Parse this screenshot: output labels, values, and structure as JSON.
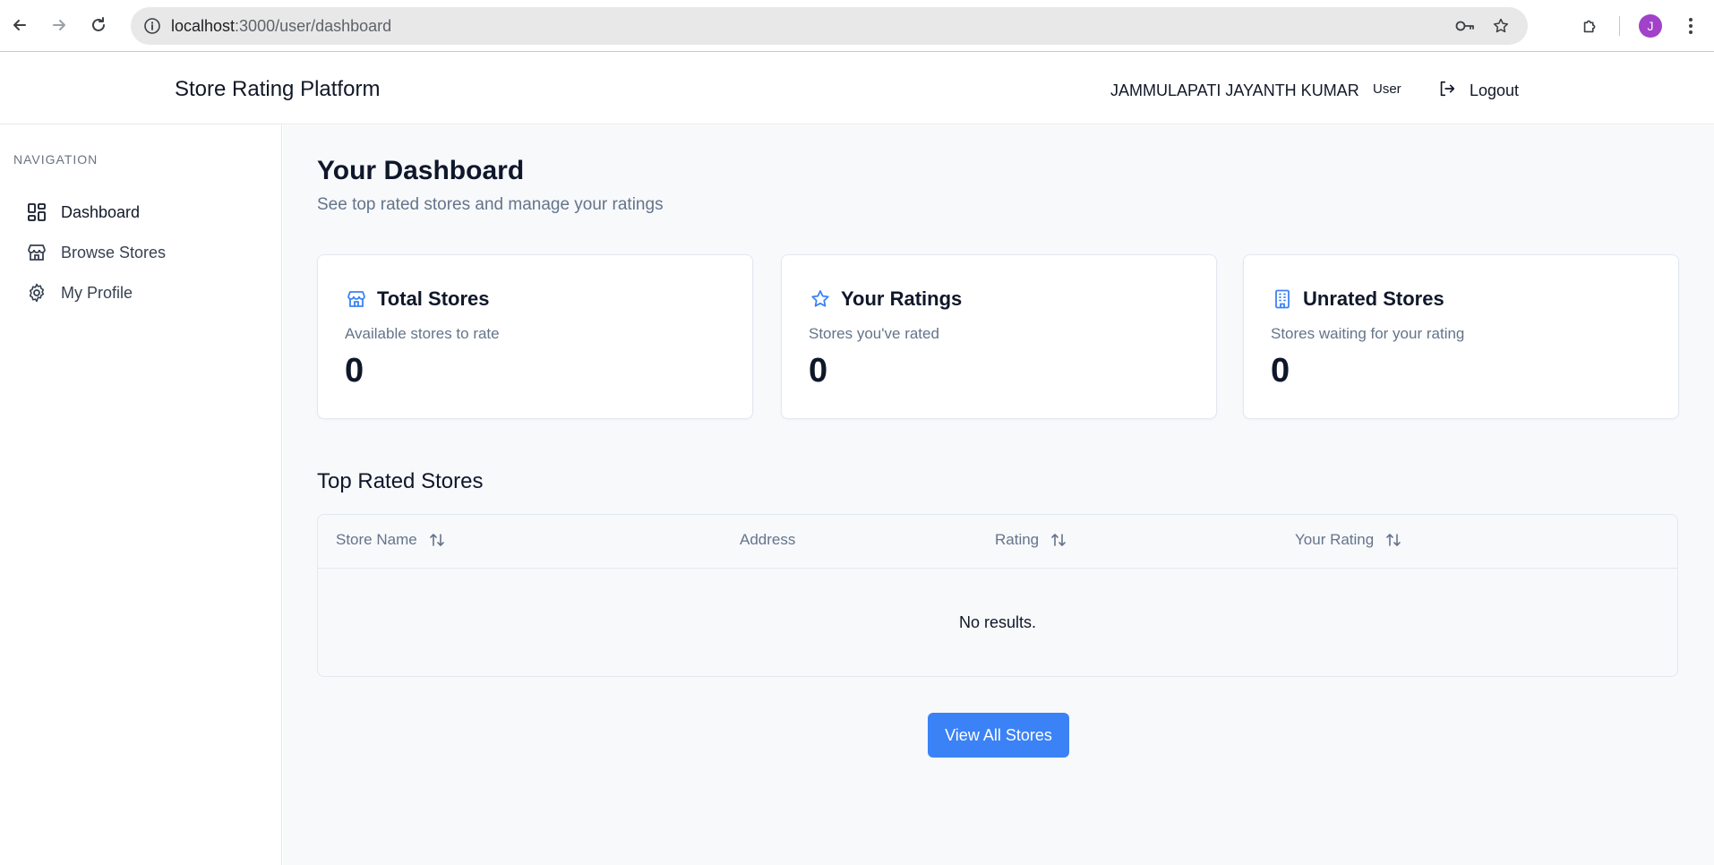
{
  "browser": {
    "url_host": "localhost",
    "url_path": ":3000/user/dashboard",
    "profile_initial": "J"
  },
  "header": {
    "app_title": "Store Rating Platform",
    "user_name": "JAMMULAPATI JAYANTH KUMAR",
    "user_role": "User",
    "logout_label": "Logout"
  },
  "sidebar": {
    "heading": "NAVIGATION",
    "items": [
      {
        "label": "Dashboard",
        "icon": "dashboard-icon",
        "active": true
      },
      {
        "label": "Browse Stores",
        "icon": "store-icon",
        "active": false
      },
      {
        "label": "My Profile",
        "icon": "gear-icon",
        "active": false
      }
    ]
  },
  "main": {
    "title": "Your Dashboard",
    "subtitle": "See top rated stores and manage your ratings",
    "cards": [
      {
        "title": "Total Stores",
        "description": "Available stores to rate",
        "value": "0",
        "icon": "store-icon"
      },
      {
        "title": "Your Ratings",
        "description": "Stores you've rated",
        "value": "0",
        "icon": "star-icon"
      },
      {
        "title": "Unrated Stores",
        "description": "Stores waiting for your rating",
        "value": "0",
        "icon": "building-icon"
      }
    ],
    "section_title": "Top Rated Stores",
    "table": {
      "columns": [
        {
          "label": "Store Name",
          "sortable": true
        },
        {
          "label": "Address",
          "sortable": false
        },
        {
          "label": "Rating",
          "sortable": true
        },
        {
          "label": "Your Rating",
          "sortable": true
        }
      ],
      "empty_text": "No results."
    },
    "view_all_label": "View All Stores"
  },
  "colors": {
    "accent": "#3b82f6",
    "profile": "#a142c9"
  }
}
